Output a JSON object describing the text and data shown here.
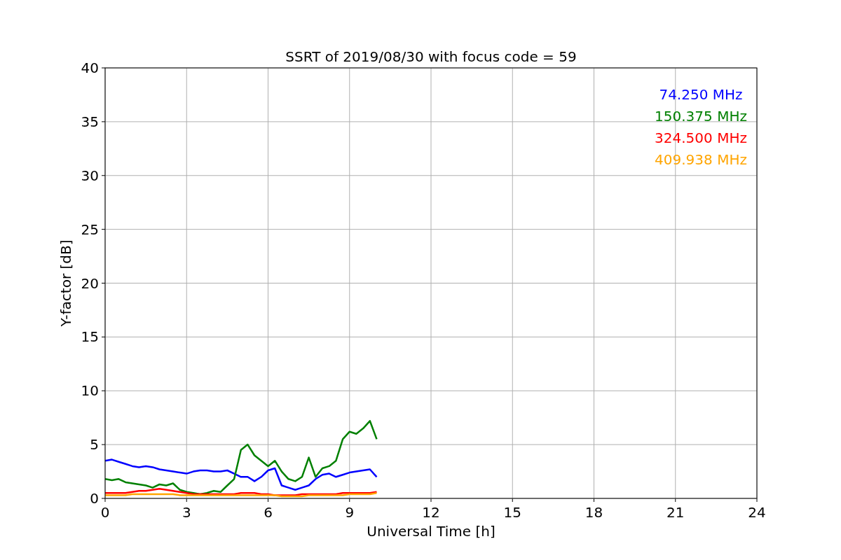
{
  "chart_data": {
    "type": "line",
    "grid": true,
    "title": "SSRT of 2019/08/30 with focus code = 59",
    "xlabel": "Universal Time [h]",
    "ylabel": "Y-factor [dB]",
    "xlim": [
      0,
      24
    ],
    "ylim": [
      0,
      40
    ],
    "xticks": [
      0,
      3,
      6,
      9,
      12,
      15,
      18,
      21,
      24
    ],
    "yticks": [
      0,
      5,
      10,
      15,
      20,
      25,
      30,
      35,
      40
    ],
    "x": [
      0,
      0.25,
      0.5,
      0.75,
      1,
      1.25,
      1.5,
      1.75,
      2,
      2.25,
      2.5,
      2.75,
      3,
      3.25,
      3.5,
      3.75,
      4,
      4.25,
      4.5,
      4.75,
      5,
      5.25,
      5.5,
      5.75,
      6,
      6.25,
      6.5,
      6.75,
      7,
      7.25,
      7.5,
      7.75,
      8,
      8.25,
      8.5,
      8.75,
      9,
      9.25,
      9.5,
      9.75,
      10
    ],
    "series": [
      {
        "name": "74.250 MHz",
        "color": "#0000ff",
        "values": [
          3.5,
          3.6,
          3.4,
          3.2,
          3.0,
          2.9,
          3.0,
          2.9,
          2.7,
          2.6,
          2.5,
          2.4,
          2.3,
          2.5,
          2.6,
          2.6,
          2.5,
          2.5,
          2.6,
          2.3,
          2.0,
          2.0,
          1.6,
          2.0,
          2.6,
          2.8,
          1.2,
          1.0,
          0.8,
          1.0,
          1.2,
          1.8,
          2.2,
          2.3,
          2.0,
          2.2,
          2.4,
          2.5,
          2.6,
          2.7,
          2.0
        ]
      },
      {
        "name": "150.375 MHz",
        "color": "#008000",
        "values": [
          1.8,
          1.7,
          1.8,
          1.5,
          1.4,
          1.3,
          1.2,
          1.0,
          1.3,
          1.2,
          1.4,
          0.8,
          0.6,
          0.5,
          0.4,
          0.5,
          0.7,
          0.6,
          1.2,
          1.8,
          4.5,
          5.0,
          4.0,
          3.5,
          3.0,
          3.5,
          2.5,
          1.8,
          1.6,
          2.0,
          3.8,
          2.0,
          2.8,
          3.0,
          3.5,
          5.5,
          6.2,
          6.0,
          6.5,
          7.2,
          5.5
        ]
      },
      {
        "name": "324.500 MHz",
        "color": "#ff0000",
        "values": [
          0.5,
          0.5,
          0.5,
          0.5,
          0.6,
          0.7,
          0.7,
          0.8,
          0.9,
          0.8,
          0.7,
          0.6,
          0.5,
          0.4,
          0.4,
          0.4,
          0.4,
          0.4,
          0.4,
          0.4,
          0.5,
          0.5,
          0.5,
          0.4,
          0.4,
          0.3,
          0.3,
          0.3,
          0.3,
          0.4,
          0.4,
          0.4,
          0.4,
          0.4,
          0.4,
          0.5,
          0.5,
          0.5,
          0.5,
          0.5,
          0.6
        ]
      },
      {
        "name": "409.938 MHz",
        "color": "#ffa500",
        "values": [
          0.3,
          0.3,
          0.3,
          0.3,
          0.4,
          0.4,
          0.4,
          0.4,
          0.4,
          0.4,
          0.4,
          0.3,
          0.3,
          0.3,
          0.3,
          0.3,
          0.3,
          0.3,
          0.3,
          0.3,
          0.3,
          0.3,
          0.3,
          0.3,
          0.3,
          0.3,
          0.2,
          0.2,
          0.2,
          0.2,
          0.3,
          0.3,
          0.3,
          0.3,
          0.3,
          0.3,
          0.4,
          0.4,
          0.4,
          0.4,
          0.5
        ]
      }
    ]
  }
}
